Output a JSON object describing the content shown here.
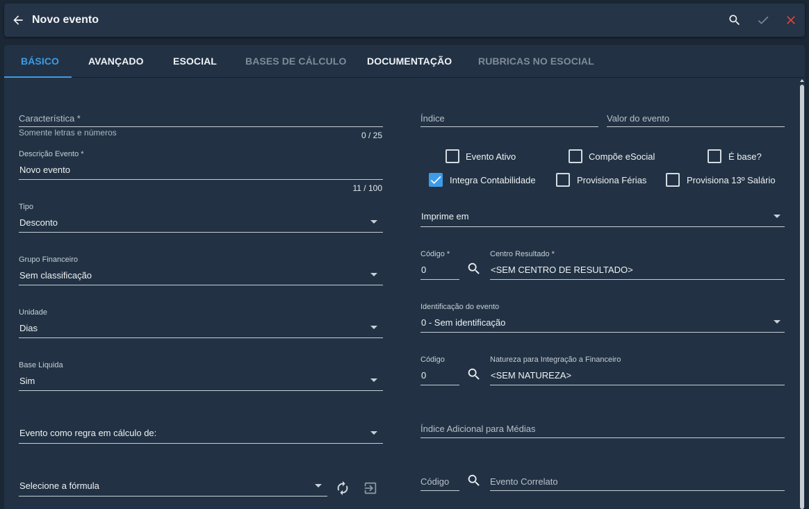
{
  "header": {
    "title": "Novo evento",
    "icons": [
      "arrow-left-icon",
      "search-icon",
      "check-icon",
      "close-icon"
    ],
    "colors": {
      "accent": "#3d9ce8",
      "close": "#e8413e"
    }
  },
  "tabs": [
    {
      "label": "BÁSICO",
      "state": "active"
    },
    {
      "label": "AVANÇADO",
      "state": "enabled"
    },
    {
      "label": "ESOCIAL",
      "state": "enabled"
    },
    {
      "label": "BASES DE CÁLCULO",
      "state": "disabled"
    },
    {
      "label": "DOCUMENTAÇÃO",
      "state": "enabled"
    },
    {
      "label": "RUBRICAS NO ESOCIAL",
      "state": "disabled"
    }
  ],
  "left": {
    "caracteristica": {
      "label": "Característica *",
      "value": "",
      "hint": "Somente letras e números",
      "counter": "0 / 25"
    },
    "descricao": {
      "label": "Descrição Evento *",
      "value": "Novo evento",
      "counter": "11 / 100"
    },
    "tipo": {
      "label": "Tipo",
      "value": "Desconto"
    },
    "grupo": {
      "label": "Grupo Financeiro",
      "value": "Sem classificação"
    },
    "unidade": {
      "label": "Unidade",
      "value": "Dias"
    },
    "base_liquida": {
      "label": "Base Liquida",
      "value": "Sim"
    },
    "evento_regra": {
      "placeholder": "Evento como regra em cálculo de:"
    },
    "formula": {
      "placeholder": "Selecione a fórmula"
    }
  },
  "right": {
    "indice": {
      "label": "Índice",
      "value": ""
    },
    "valor_evento": {
      "label": "Valor do evento",
      "value": ""
    },
    "checkboxes": [
      {
        "label": "Evento Ativo",
        "checked": false
      },
      {
        "label": "Compõe eSocial",
        "checked": false
      },
      {
        "label": "É base?",
        "checked": false
      },
      {
        "label": "Integra Contabilidade",
        "checked": true
      },
      {
        "label": "Provisiona Férias",
        "checked": false
      },
      {
        "label": "Provisiona 13º Salário",
        "checked": false
      }
    ],
    "imprime_em": {
      "placeholder": "Imprime em"
    },
    "centro_codigo": {
      "label": "Código *",
      "value": "0"
    },
    "centro_resultado": {
      "label": "Centro Resultado *",
      "value": "<SEM CENTRO DE RESULTADO>"
    },
    "identificacao": {
      "label": "Identificação do evento",
      "value": "0 - Sem identificação"
    },
    "natureza_codigo": {
      "label": "Código",
      "value": "0"
    },
    "natureza": {
      "label": "Natureza para Integração a Financeiro",
      "value": "<SEM NATUREZA>"
    },
    "indice_adicional": {
      "label": "Índice Adicional para Médias",
      "value": ""
    },
    "correlato_codigo": {
      "label": "Código",
      "value": ""
    },
    "correlato": {
      "label": "Evento Correlato",
      "value": ""
    }
  }
}
